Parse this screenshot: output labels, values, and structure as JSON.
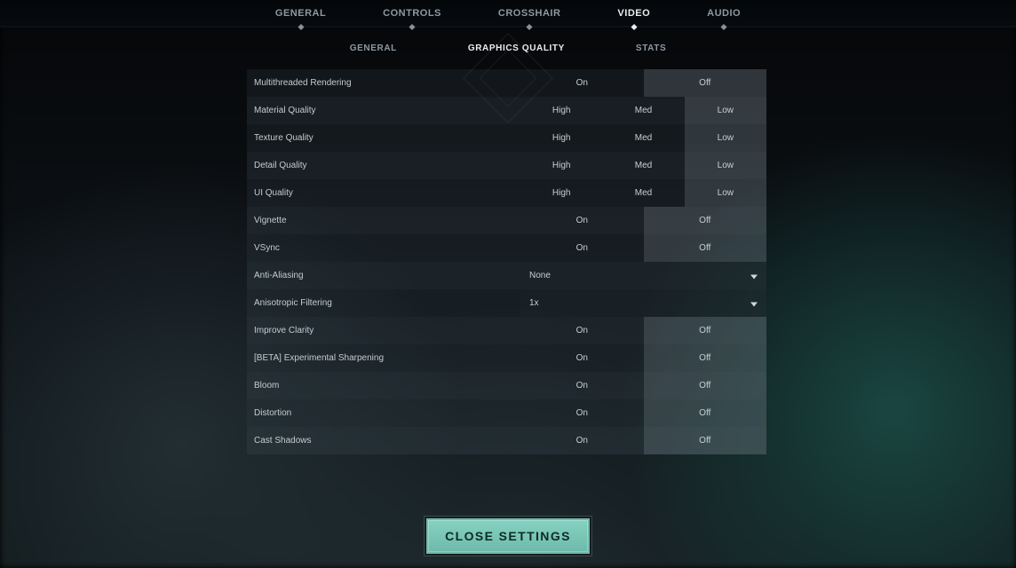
{
  "topnav": {
    "items": [
      "GENERAL",
      "CONTROLS",
      "CROSSHAIR",
      "VIDEO",
      "AUDIO"
    ],
    "active_index": 3
  },
  "subnav": {
    "items": [
      "GENERAL",
      "GRAPHICS QUALITY",
      "STATS"
    ],
    "active_index": 1
  },
  "settings": [
    {
      "label": "Multithreaded Rendering",
      "type": "onoff",
      "options": [
        "On",
        "Off"
      ],
      "selected": 1
    },
    {
      "label": "Material Quality",
      "type": "tri",
      "options": [
        "High",
        "Med",
        "Low"
      ],
      "selected": 2
    },
    {
      "label": "Texture Quality",
      "type": "tri",
      "options": [
        "High",
        "Med",
        "Low"
      ],
      "selected": 2
    },
    {
      "label": "Detail Quality",
      "type": "tri",
      "options": [
        "High",
        "Med",
        "Low"
      ],
      "selected": 2
    },
    {
      "label": "UI Quality",
      "type": "tri",
      "options": [
        "High",
        "Med",
        "Low"
      ],
      "selected": 2
    },
    {
      "label": "Vignette",
      "type": "onoff",
      "options": [
        "On",
        "Off"
      ],
      "selected": 1
    },
    {
      "label": "VSync",
      "type": "onoff",
      "options": [
        "On",
        "Off"
      ],
      "selected": 1
    },
    {
      "label": "Anti-Aliasing",
      "type": "dropdown",
      "value": "None"
    },
    {
      "label": "Anisotropic Filtering",
      "type": "dropdown",
      "value": "1x"
    },
    {
      "label": "Improve Clarity",
      "type": "onoff",
      "options": [
        "On",
        "Off"
      ],
      "selected": 1
    },
    {
      "label": "[BETA] Experimental Sharpening",
      "type": "onoff",
      "options": [
        "On",
        "Off"
      ],
      "selected": 1
    },
    {
      "label": "Bloom",
      "type": "onoff",
      "options": [
        "On",
        "Off"
      ],
      "selected": 1
    },
    {
      "label": "Distortion",
      "type": "onoff",
      "options": [
        "On",
        "Off"
      ],
      "selected": 1
    },
    {
      "label": "Cast Shadows",
      "type": "onoff",
      "options": [
        "On",
        "Off"
      ],
      "selected": 1
    }
  ],
  "close_button": "CLOSE SETTINGS"
}
